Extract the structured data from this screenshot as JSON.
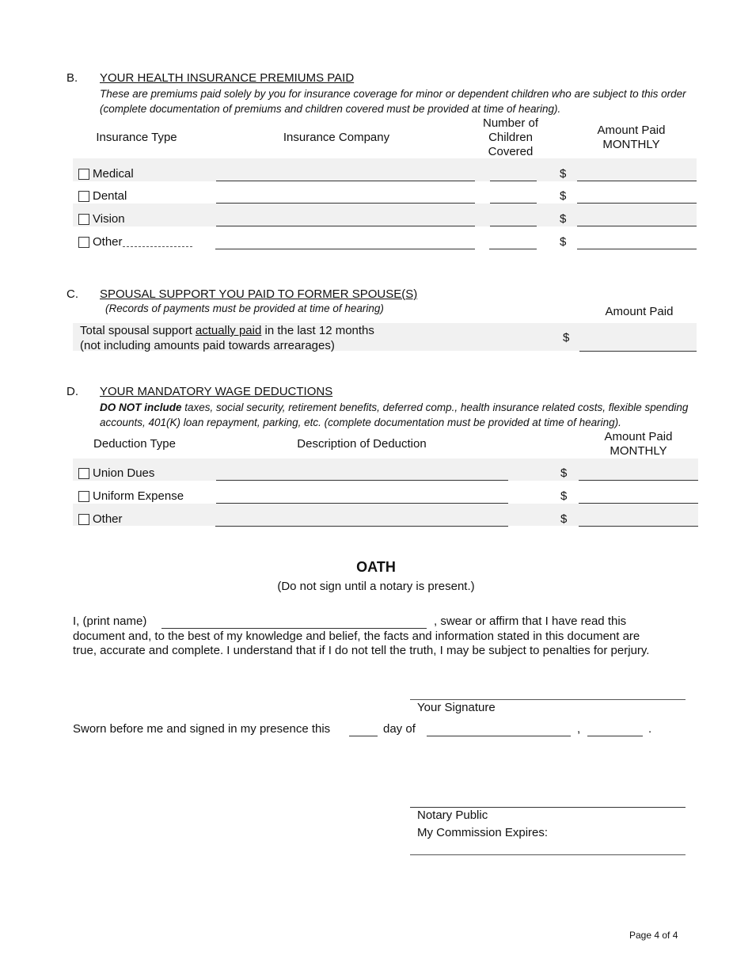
{
  "section_b": {
    "letter": "B.",
    "title": "YOUR HEALTH INSURANCE PREMIUMS PAID",
    "note": "These are premiums paid solely by you for insurance coverage for minor or dependent children who are subject to this order (complete documentation of premiums and children covered must be provided at time of hearing).",
    "columns": {
      "type": "Insurance Type",
      "company": "Insurance Company",
      "children_l1": "Number of",
      "children_l2": "Children",
      "children_l3": "Covered",
      "amount_l1": "Amount Paid",
      "amount_l2": "MONTHLY"
    },
    "rows": [
      {
        "label": "Medical",
        "currency": "$",
        "checked": false
      },
      {
        "label": "Dental",
        "currency": "$",
        "checked": false
      },
      {
        "label": "Vision",
        "currency": "$",
        "checked": false
      },
      {
        "label": "Other",
        "currency": "$",
        "checked": false
      }
    ]
  },
  "section_c": {
    "letter": "C.",
    "title": "SPOUSAL SUPPORT YOU PAID TO FORMER SPOUSE(S)",
    "note": "(Records of payments must be provided at time of hearing)",
    "amount_header": "Amount Paid",
    "line1_pre": "Total spousal support ",
    "line1_underlined": "actually paid",
    "line1_post": " in the last 12 months",
    "line2": "(not including amounts paid towards arrearages)",
    "currency": "$"
  },
  "section_d": {
    "letter": "D.",
    "title": "YOUR MANDATORY WAGE DEDUCTIONS",
    "note_bold": "DO NOT include",
    "note_rest": " taxes, social security, retirement benefits, deferred comp., health insurance related costs, flexible spending accounts, 401(K) loan repayment, parking, etc. (complete documentation must be provided at time of hearing).",
    "columns": {
      "type": "Deduction Type",
      "description": "Description of Deduction",
      "amount_l1": "Amount Paid",
      "amount_l2": "MONTHLY"
    },
    "rows": [
      {
        "label": "Union Dues",
        "currency": "$",
        "checked": false
      },
      {
        "label": "Uniform Expense",
        "currency": "$",
        "checked": false
      },
      {
        "label": "Other",
        "currency": "$",
        "checked": false
      }
    ]
  },
  "oath": {
    "title": "OATH",
    "subtitle": "(Do not sign until a notary is present.)",
    "print_name_label": "I, (print name)",
    "line1_rest": ", swear or affirm that I have read this",
    "line2": "document and, to the best of my knowledge and belief, the facts and information stated in this document are",
    "line3": "true, accurate and complete.  I understand that if I do not tell the truth, I may be subject to penalties for perjury.",
    "signature_label": "Your Signature",
    "sworn_pre": "Sworn before me and signed in my presence this",
    "sworn_dayof": "day of",
    "comma": ",",
    "period": ".",
    "notary_label": "Notary Public",
    "commission_label": "My Commission Expires:"
  },
  "footer": {
    "page": "Page 4 of 4"
  }
}
